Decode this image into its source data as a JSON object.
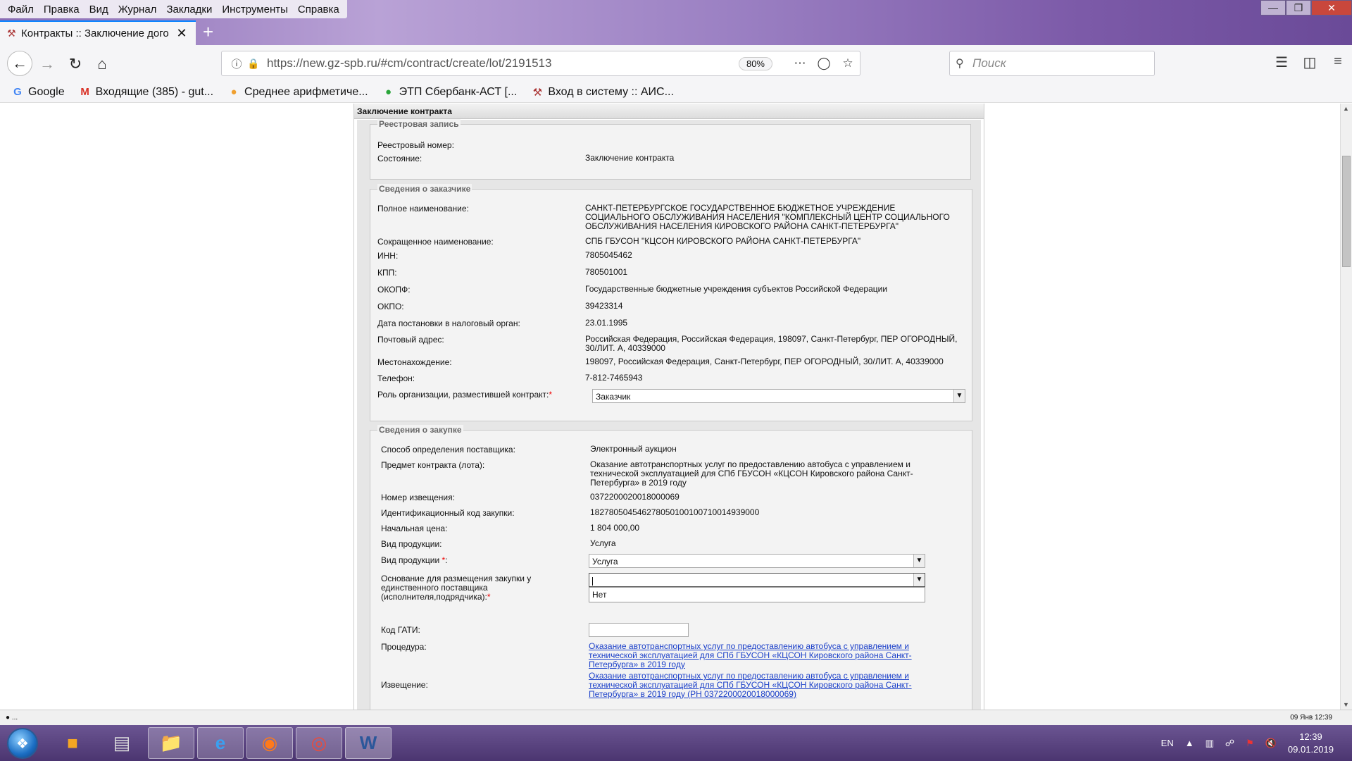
{
  "browser": {
    "menu": [
      "Файл",
      "Правка",
      "Вид",
      "Журнал",
      "Закладки",
      "Инструменты",
      "Справка"
    ],
    "tab_title": "Контракты :: Заключение дого",
    "url": "https://new.gz-spb.ru/#cm/contract/create/lot/2191513",
    "zoom": "80%",
    "search_placeholder": "Поиск",
    "bookmarks": [
      {
        "label": "Google",
        "icon": "google-icon"
      },
      {
        "label": "Входящие (385) - gut...",
        "icon": "gmail-icon"
      },
      {
        "label": "Среднее арифметиче...",
        "icon": "orange-icon"
      },
      {
        "label": "ЭТП Сбербанк-АСТ [...",
        "icon": "sberbank-icon"
      },
      {
        "label": "Вход в систему :: АИС...",
        "icon": "ais-icon"
      }
    ]
  },
  "panel": {
    "title": "Заключение контракта",
    "registry": {
      "legend": "Реестровая запись",
      "number_label": "Реестровый номер:",
      "number_value": "",
      "state_label": "Состояние:",
      "state_value": "Заключение контракта"
    },
    "customer": {
      "legend": "Сведения о заказчике",
      "rows": [
        {
          "label": "Полное наименование:",
          "value": "САНКТ-ПЕТЕРБУРГСКОЕ ГОСУДАРСТВЕННОЕ БЮДЖЕТНОЕ УЧРЕЖДЕНИЕ СОЦИАЛЬНОГО ОБСЛУЖИВАНИЯ НАСЕЛЕНИЯ \"КОМПЛЕКСНЫЙ ЦЕНТР СОЦИАЛЬНОГО ОБСЛУЖИВАНИЯ НАСЕЛЕНИЯ КИРОВСКОГО РАЙОНА САНКТ-ПЕТЕРБУРГА\""
        },
        {
          "label": "Сокращенное наименование:",
          "value": "СПБ ГБУСОН \"КЦСОН КИРОВСКОГО РАЙОНА САНКТ-ПЕТЕРБУРГА\""
        },
        {
          "label": "ИНН:",
          "value": "7805045462"
        },
        {
          "label": "КПП:",
          "value": "780501001"
        },
        {
          "label": "ОКОПФ:",
          "value": "Государственные бюджетные учреждения субъектов Российской Федерации"
        },
        {
          "label": "ОКПО:",
          "value": "39423314"
        },
        {
          "label": "Дата постановки в налоговый орган:",
          "value": "23.01.1995"
        },
        {
          "label": "Почтовый адрес:",
          "value": "Российская Федерация, Российская Федерация, 198097, Санкт-Петербург, ПЕР ОГОРОДНЫЙ, 30/ЛИТ. А, 40339000"
        },
        {
          "label": "Местонахождение:",
          "value": "198097, Российская Федерация, Санкт-Петербург, ПЕР ОГОРОДНЫЙ, 30/ЛИТ. А, 40339000"
        },
        {
          "label": "Телефон:",
          "value": "7-812-7465943"
        }
      ],
      "role_label": "Роль организации, разместившей контракт:",
      "role_value": "Заказчик"
    },
    "purchase": {
      "legend": "Сведения о закупке",
      "rows": [
        {
          "label": "Способ определения поставщика:",
          "value": "Электронный аукцион"
        },
        {
          "label": "Предмет контракта (лота):",
          "value": "Оказание автотранспортных услуг по предоставлению автобуса с управлением и технической эксплуатацией для СПб ГБУСОН «КЦСОН Кировского района Санкт-Петербурга» в 2019 году"
        },
        {
          "label": "Номер извещения:",
          "value": "0372200020018000069"
        },
        {
          "label": "Идентификационный код закупки:",
          "value": "182780504546278050100100710014939000"
        },
        {
          "label": "Начальная цена:",
          "value": "1 804 000,00"
        },
        {
          "label": "Вид продукции:",
          "value": "Услуга"
        }
      ],
      "product_type_label": "Вид продукции",
      "product_type_value": "Услуга",
      "basis_label": "Основание для размещения закупки у единственного поставщика (исполнителя,подрядчика):",
      "basis_value": "",
      "basis_option": "Нет",
      "gati_label": "Код ГАТИ:",
      "procedure_label": "Процедура:",
      "procedure_link": "Оказание автотранспортных услуг по предоставлению автобуса с управлением и технической эксплуатацией для СПб ГБУСОН «КЦСОН Кировского района Санкт-Петербурга» в 2019 году",
      "notice_label": "Извещение:",
      "notice_link": "Оказание автотранспортных услуг по предоставлению автобуса с управлением и технической эксплуатацией для СПб ГБУСОН «КЦСОН Кировского района Санкт-Петербурга» в 2019 году (РН 0372200020018000069)"
    }
  },
  "status": {
    "left": "...",
    "right": "09 Янв 12:39"
  },
  "taskbar": {
    "lang": "EN",
    "time": "12:39",
    "date": "09.01.2019"
  }
}
